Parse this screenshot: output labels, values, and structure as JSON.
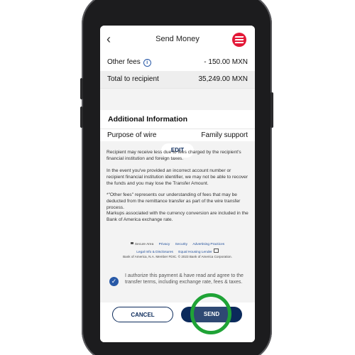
{
  "header": {
    "back_icon": "chevron-left-icon",
    "title": "Send Money",
    "logo_icon": "bank-logo-icon"
  },
  "summary": {
    "other_fees_label": "Other fees",
    "other_fees_value": "- 150.00 MXN",
    "total_label": "Total to recipient",
    "total_value": "35,249.00 MXN"
  },
  "additional": {
    "heading": "Additional Information",
    "purpose_label": "Purpose of wire",
    "purpose_value": "Family support",
    "edit_label": "EDIT"
  },
  "disclaimers": [
    "Recipient may receive less due to fees charged by the recipient's financial institution and foreign taxes.",
    "In the event you've provided an incorrect account number or recipient financial institution identifier, we may not be able to recover the funds and you may lose the Transfer Amount.",
    "*\"Other fees\" represents our understanding of fees that may be deducted from the remittance transfer as part of the wire transfer process.",
    "Markups associated with the currency conversion are included in the Bank of America exchange rate."
  ],
  "footer": {
    "secure_area": "Secure Area",
    "privacy": "Privacy",
    "security": "Security",
    "advertising": "Advertising Practices",
    "legal": "Legal Info & Disclosures",
    "equal_housing": "Equal Housing Lender",
    "copyright": "Bank of America, N.A. Member FDIC. © 2023 Bank of America Corporation."
  },
  "authorization": {
    "checked": true,
    "text": "I authorize this payment & have read and agree to the transfer terms, including exchange rate, fees & taxes."
  },
  "actions": {
    "cancel_label": "CANCEL",
    "send_label": "SEND"
  },
  "colors": {
    "brand_navy": "#0b2a5b",
    "link_blue": "#2859a7",
    "logo_red": "#e31837",
    "highlight_green": "#1fa336"
  }
}
